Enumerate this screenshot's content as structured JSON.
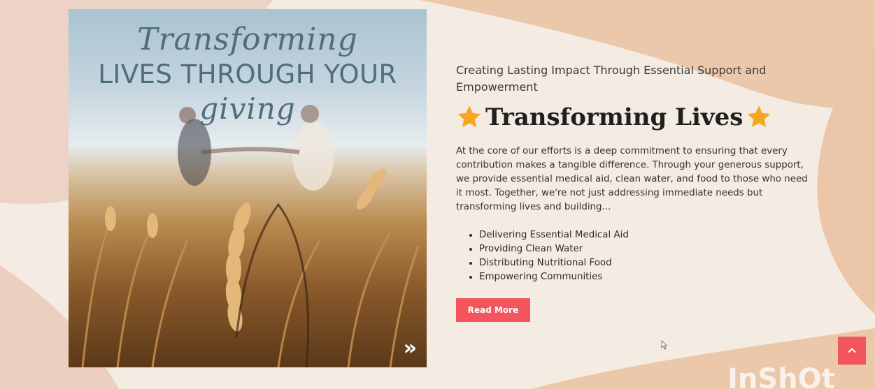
{
  "hero_image": {
    "script_line_1": "Transforming",
    "caps_line": "LIVES THROUGH YOUR",
    "script_line_2": "giving",
    "next_icon": "double-chevron-right-icon",
    "next_glyph": "»"
  },
  "content": {
    "subtitle": "Creating Lasting Impact Through Essential Support and Empowerment",
    "title": "Transforming Lives",
    "title_icon": "star-icon",
    "body": "At the core of our efforts is a deep commitment to ensuring that every contribution makes a tangible difference. Through your generous support, we provide essential medical aid, clean water, and food to those who need it most. Together, we're not just addressing immediate needs but transforming lives and building...",
    "features": [
      "Delivering Essential Medical Aid",
      "Providing Clean Water",
      "Distributing Nutritional Food",
      "Empowering Communities"
    ],
    "read_more_label": "Read More"
  },
  "scroll_top": {
    "icon": "chevron-up-icon"
  },
  "watermark": {
    "text": "InShOt"
  },
  "colors": {
    "accent": "#f2555c",
    "star": "#f6a623",
    "heading": "#1f1f1f",
    "image_text": "#4f6d7c",
    "background": "#f3e9df",
    "blob": "#e9c3a6"
  }
}
